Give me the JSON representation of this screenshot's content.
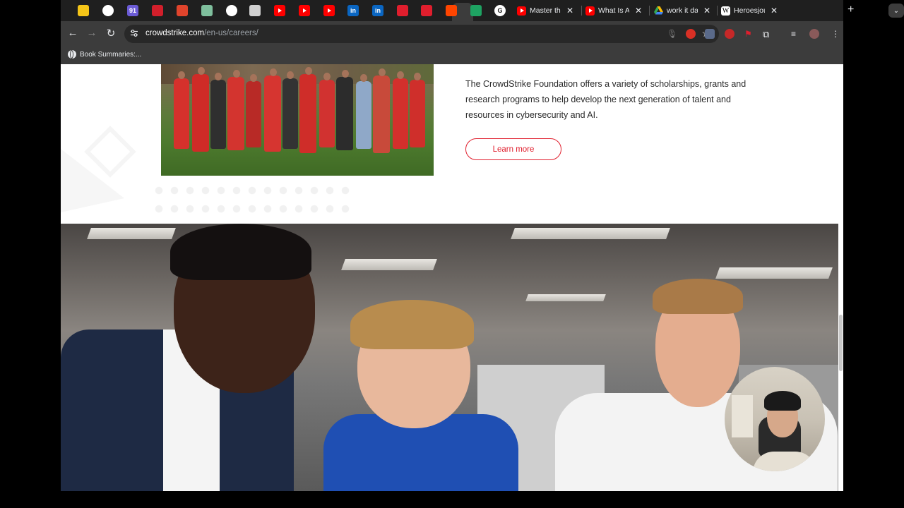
{
  "tabs": {
    "pinned": [
      {
        "icon": "miro-icon",
        "color": "#f5c518",
        "text": ""
      },
      {
        "icon": "info-icon",
        "color": "#ffffff",
        "text": ""
      },
      {
        "icon": "badge-icon",
        "color": "#6b5bd6",
        "text": "91"
      },
      {
        "icon": "m-logo-icon",
        "color": "#d21f2b",
        "text": ""
      },
      {
        "icon": "bookmark-ribbon-icon",
        "color": "#e0442c",
        "text": ""
      },
      {
        "icon": "maps-grid-icon",
        "color": "#7fbf9d",
        "text": ""
      },
      {
        "icon": "compass-icon",
        "color": "#ffffff",
        "text": ""
      },
      {
        "icon": "shield-icon",
        "color": "#cfcfcf",
        "text": ""
      },
      {
        "icon": "youtube-icon",
        "color": "#ff0000",
        "text": ""
      },
      {
        "icon": "youtube-icon",
        "color": "#ff0000",
        "text": ""
      },
      {
        "icon": "youtube-icon",
        "color": "#ff0000",
        "text": ""
      },
      {
        "icon": "linkedin-icon",
        "color": "#0a66c2",
        "text": "in"
      },
      {
        "icon": "linkedin-icon",
        "color": "#0a66c2",
        "text": "in"
      },
      {
        "icon": "crowdstrike-icon",
        "color": "#e01e2d",
        "text": ""
      },
      {
        "icon": "crowdstrike-icon",
        "color": "#e01e2d",
        "text": ""
      },
      {
        "icon": "reddit-icon",
        "color": "#ff4500",
        "text": ""
      },
      {
        "icon": "sheets-icon",
        "color": "#1ea362",
        "text": ""
      },
      {
        "icon": "google-icon",
        "color": "#ffffff",
        "text": "G"
      }
    ],
    "open": [
      {
        "title": "Master th",
        "favicon": "youtube-icon",
        "color": "#ff0000"
      },
      {
        "title": "What Is A",
        "favicon": "youtube-icon",
        "color": "#ff0000"
      },
      {
        "title": "work it da",
        "favicon": "drive-icon",
        "color": "#34a853"
      },
      {
        "title": "Heroesjou",
        "favicon": "wikipedia-icon",
        "color": "#ffffff"
      }
    ]
  },
  "toolbar": {
    "url_host": "crowdstrike.com",
    "url_path": "/en-us/careers/"
  },
  "bookmarks": [
    {
      "label": "Book Summaries:..."
    }
  ],
  "content": {
    "foundation_text": "The CrowdStrike Foundation offers a variety of scholarships, grants and research programs to help develop the next generation of talent and resources in cybersecurity and AI.",
    "learn_more_label": "Learn more"
  },
  "colors": {
    "brand_red": "#e01e2d",
    "chrome_dark": "#3c3c3c"
  }
}
